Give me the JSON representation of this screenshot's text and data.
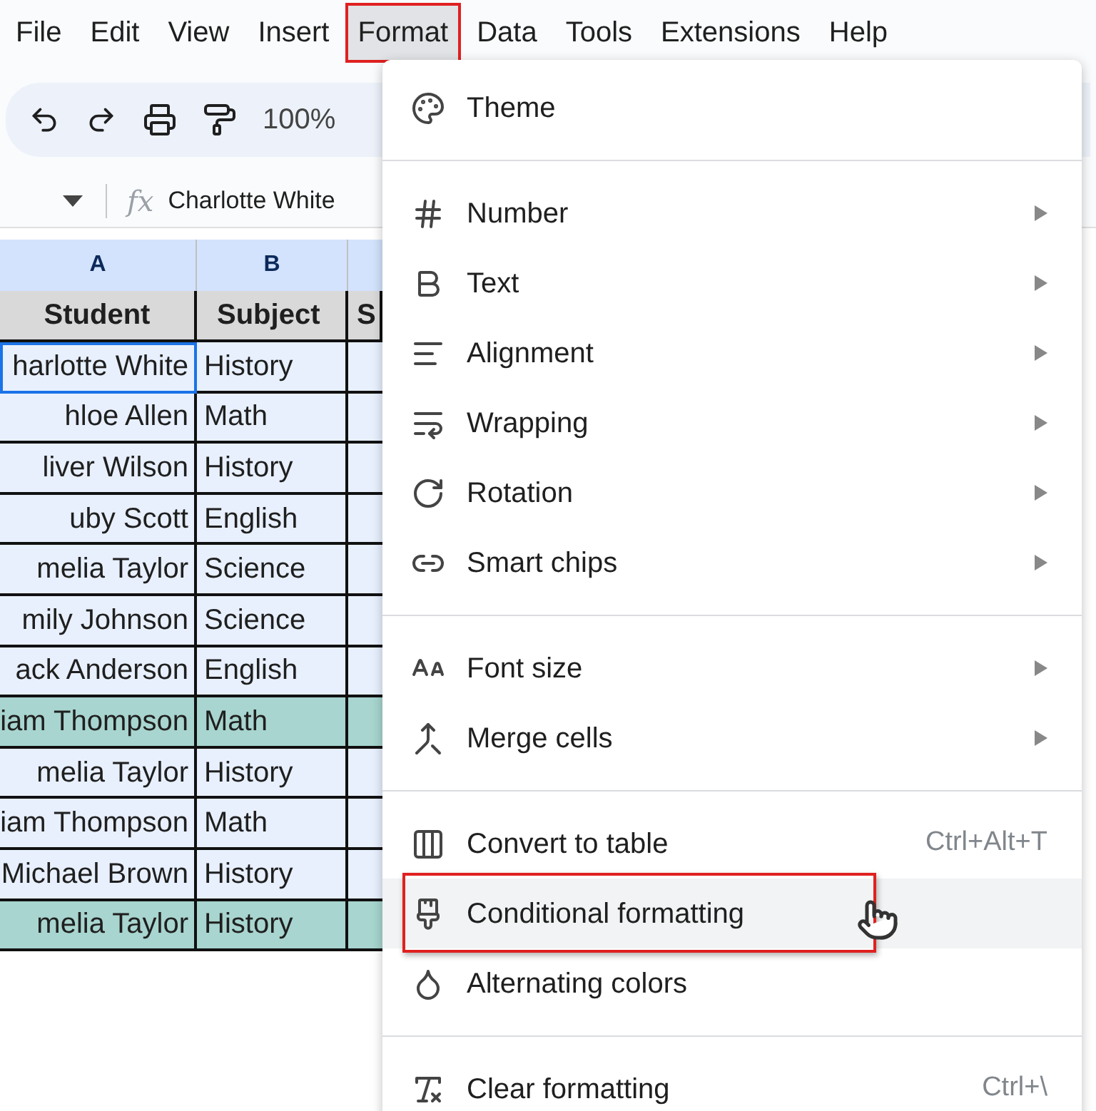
{
  "menu_bar": [
    {
      "label": "File",
      "selected": false
    },
    {
      "label": "Edit",
      "selected": false
    },
    {
      "label": "View",
      "selected": false
    },
    {
      "label": "Insert",
      "selected": false
    },
    {
      "label": "Format",
      "selected": true
    },
    {
      "label": "Data",
      "selected": false
    },
    {
      "label": "Tools",
      "selected": false
    },
    {
      "label": "Extensions",
      "selected": false
    },
    {
      "label": "Help",
      "selected": false
    }
  ],
  "toolbar": {
    "zoom": "100%"
  },
  "formula_bar": {
    "icon_text": "fx",
    "value": "Charlotte White"
  },
  "sheet": {
    "column_headers": [
      "A",
      "B"
    ],
    "header_row": [
      "Student",
      "Subject",
      "S"
    ],
    "rows": [
      {
        "cells": [
          "harlotte White",
          "History"
        ],
        "highlighted": false,
        "selected": true
      },
      {
        "cells": [
          "hloe Allen",
          "Math"
        ],
        "highlighted": false,
        "selected": false
      },
      {
        "cells": [
          "liver Wilson",
          "History"
        ],
        "highlighted": false,
        "selected": false
      },
      {
        "cells": [
          "uby Scott",
          "English"
        ],
        "highlighted": false,
        "selected": false
      },
      {
        "cells": [
          "melia Taylor",
          "Science"
        ],
        "highlighted": false,
        "selected": false
      },
      {
        "cells": [
          "mily Johnson",
          "Science"
        ],
        "highlighted": false,
        "selected": false
      },
      {
        "cells": [
          "ack Anderson",
          "English"
        ],
        "highlighted": false,
        "selected": false
      },
      {
        "cells": [
          "iam Thompson",
          "Math"
        ],
        "highlighted": true,
        "selected": false
      },
      {
        "cells": [
          "melia Taylor",
          "History"
        ],
        "highlighted": false,
        "selected": false
      },
      {
        "cells": [
          "iam Thompson",
          "Math"
        ],
        "highlighted": false,
        "selected": false
      },
      {
        "cells": [
          "Michael Brown",
          "History"
        ],
        "highlighted": false,
        "selected": false
      },
      {
        "cells": [
          "melia Taylor",
          "History"
        ],
        "highlighted": true,
        "selected": false
      }
    ]
  },
  "format_menu": {
    "groups": [
      [
        {
          "label": "Theme",
          "submenu": false,
          "hovered": false
        }
      ],
      [
        {
          "label": "Number",
          "submenu": true,
          "hovered": false
        },
        {
          "label": "Text",
          "submenu": true,
          "hovered": false
        },
        {
          "label": "Alignment",
          "submenu": true,
          "hovered": false
        },
        {
          "label": "Wrapping",
          "submenu": true,
          "hovered": false
        },
        {
          "label": "Rotation",
          "submenu": true,
          "hovered": false
        },
        {
          "label": "Smart chips",
          "submenu": true,
          "hovered": false
        }
      ],
      [
        {
          "label": "Font size",
          "submenu": true,
          "hovered": false
        },
        {
          "label": "Merge cells",
          "submenu": true,
          "hovered": false
        }
      ],
      [
        {
          "label": "Convert to table",
          "submenu": false,
          "hovered": false,
          "shortcut": "Ctrl+Alt+T"
        },
        {
          "label": "Conditional formatting",
          "submenu": false,
          "hovered": true
        },
        {
          "label": "Alternating colors",
          "submenu": false,
          "hovered": false
        }
      ],
      [
        {
          "label": "Clear formatting",
          "submenu": false,
          "hovered": false,
          "shortcut": "Ctrl+\\"
        }
      ]
    ]
  }
}
